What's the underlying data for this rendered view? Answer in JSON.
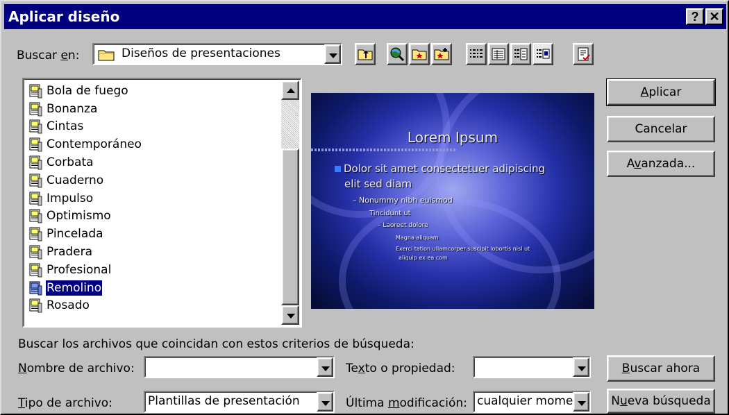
{
  "window": {
    "title": "Aplicar diseño",
    "help_label": "?",
    "close_label": "✕"
  },
  "look_in": {
    "label_before": "Buscar ",
    "label_accel": "e",
    "label_after": "n:",
    "value": "Diseños de presentaciones",
    "icon": "folder-icon"
  },
  "toolbar": {
    "items": [
      "up-one-level-icon",
      "search-web-icon",
      "look-in-favorites-icon",
      "add-to-favorites-icon",
      "list-view-icon",
      "details-view-icon",
      "properties-view-icon",
      "preview-view-icon",
      "commands-and-settings-icon"
    ],
    "active": "preview-view-icon"
  },
  "files": {
    "items": [
      "Bola de fuego",
      "Bonanza",
      "Cintas",
      "Contemporáneo",
      "Corbata",
      "Cuaderno",
      "Impulso",
      "Optimismo",
      "Pincelada",
      "Pradera",
      "Profesional",
      "Remolino",
      "Rosado"
    ],
    "selected": "Remolino",
    "icon": "presentation-template-icon"
  },
  "preview": {
    "title": "Lorem Ipsum",
    "bullet1_line1": "Dolor sit amet consectetuer adipiscing",
    "bullet1_line2": "elit sed diam",
    "level2": "– Nonummy nibh euismod",
    "level3": "Tincidunt ut",
    "level4": "– Laoreet dolore",
    "level5a": "Magna aliquam",
    "level5b_line1": "Exerci tation ullamcorper suscipit lobortis nisl ut",
    "level5b_line2": "aliquip ex ea com"
  },
  "buttons": {
    "apply_accel": "A",
    "apply_rest": "plicar",
    "cancel": "Cancelar",
    "advanced_before": "A",
    "advanced_accel": "v",
    "advanced_after": "anzada...",
    "find_now_accel": "B",
    "find_now_rest": "uscar ahora",
    "new_search_before": "N",
    "new_search_accel": "u",
    "new_search_after": "eva búsqueda"
  },
  "search": {
    "criteria_label": "Buscar los archivos que coincidan con estos criterios de búsqueda:",
    "filename_accel": "N",
    "filename_rest": "ombre de archivo:",
    "filename_value": "",
    "text_before": "Te",
    "text_accel": "x",
    "text_after": "to o propiedad:",
    "text_value": "",
    "filetype_accel": "T",
    "filetype_rest": "ipo de archivo:",
    "filetype_value": "Plantillas de presentación",
    "modified_before": "Última ",
    "modified_accel": "m",
    "modified_after": "odificación:",
    "modified_value": "cualquier mome"
  }
}
